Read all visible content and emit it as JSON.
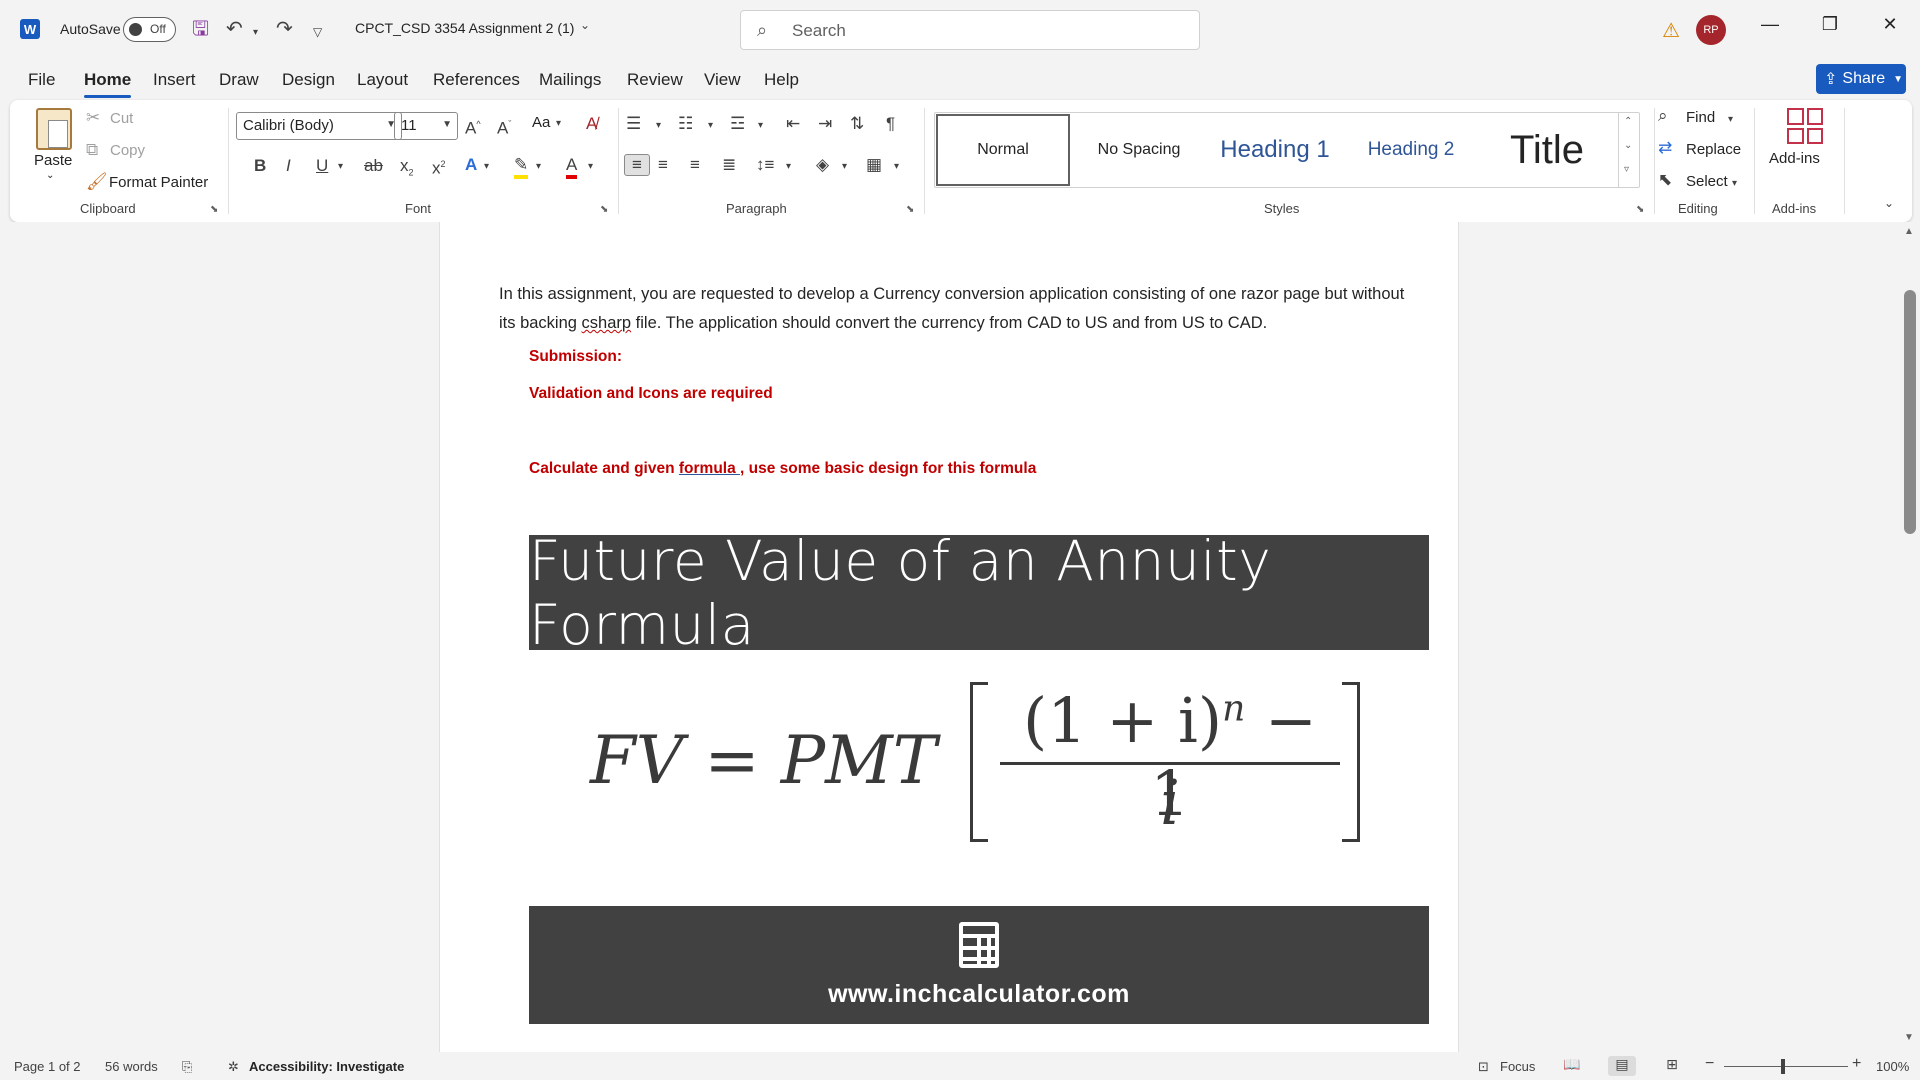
{
  "titlebar": {
    "app_logo": "W",
    "autosave_label": "AutoSave",
    "autosave_state": "Off",
    "doc_title": "CPCT_CSD 3354 Assignment 2 (1)",
    "search_placeholder": "Search",
    "avatar_initials": "RP"
  },
  "tabs": [
    "File",
    "Home",
    "Insert",
    "Draw",
    "Design",
    "Layout",
    "References",
    "Mailings",
    "Review",
    "View",
    "Help"
  ],
  "active_tab": "Home",
  "share_label": "Share",
  "ribbon": {
    "clipboard": {
      "paste": "Paste",
      "cut": "Cut",
      "copy": "Copy",
      "format_painter": "Format Painter",
      "label": "Clipboard"
    },
    "font": {
      "font_name": "Calibri (Body)",
      "font_size": "11",
      "change_case": "Aa",
      "label": "Font"
    },
    "paragraph": {
      "label": "Paragraph"
    },
    "styles": {
      "items": [
        "Normal",
        "No Spacing",
        "Heading 1",
        "Heading 2",
        "Title"
      ],
      "label": "Styles"
    },
    "editing": {
      "find": "Find",
      "replace": "Replace",
      "select": "Select",
      "label": "Editing"
    },
    "addins": {
      "button": "Add-ins",
      "label": "Add-ins"
    }
  },
  "document": {
    "para_part1": "In this assignment, you are requested to develop a Currency conversion application consisting of one razor page but without its backing ",
    "para_misspelled": "csharp",
    "para_part2": " file. The application should convert the currency from CAD to US and from US to CAD.",
    "submission": "Submission:",
    "validation": "Validation and Icons are required",
    "calc_prefix": "Calculate and given ",
    "calc_link": "formula ,",
    "calc_suffix": " use some basic design for this formula",
    "banner_title": "Future Value of an Annuity Formula",
    "formula_lhs": "FV = PMT",
    "formula_numerator": "(1 + i)",
    "formula_exponent": "n",
    "formula_numerator_tail": " − 1",
    "formula_denominator": "i",
    "banner_url": "www.inchcalculator.com"
  },
  "statusbar": {
    "page": "Page 1 of 2",
    "words": "56 words",
    "accessibility": "Accessibility: Investigate",
    "focus": "Focus",
    "zoom": "100%"
  },
  "colors": {
    "brand": "#185abd",
    "red_text": "#c00000",
    "banner": "#414141",
    "avatar": "#a4262c",
    "heading_blue": "#2f5597"
  }
}
